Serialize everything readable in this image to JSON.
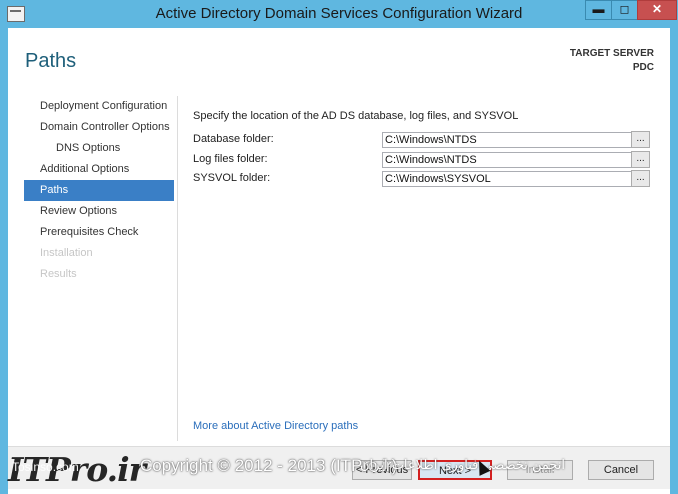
{
  "window": {
    "title": "Active Directory Domain Services Configuration Wizard",
    "controls": {
      "minimize": "▬",
      "maximize": "◻",
      "close": "✕"
    }
  },
  "header": {
    "page_title": "Paths",
    "target_label": "TARGET SERVER",
    "target_server": "PDC"
  },
  "sidebar": {
    "items": [
      {
        "label": "Deployment Configuration",
        "state": "normal"
      },
      {
        "label": "Domain Controller Options",
        "state": "normal"
      },
      {
        "label": "DNS Options",
        "state": "sub"
      },
      {
        "label": "Additional Options",
        "state": "normal"
      },
      {
        "label": "Paths",
        "state": "active"
      },
      {
        "label": "Review Options",
        "state": "normal"
      },
      {
        "label": "Prerequisites Check",
        "state": "normal"
      },
      {
        "label": "Installation",
        "state": "disabled"
      },
      {
        "label": "Results",
        "state": "disabled"
      }
    ]
  },
  "main": {
    "instruction": "Specify the location of the AD DS database, log files, and SYSVOL",
    "fields": [
      {
        "label": "Database folder:",
        "value": "C:\\Windows\\NTDS",
        "browse": "..."
      },
      {
        "label": "Log files folder:",
        "value": "C:\\Windows\\NTDS",
        "browse": "..."
      },
      {
        "label": "SYSVOL folder:",
        "value": "C:\\Windows\\SYSVOL",
        "browse": "..."
      }
    ],
    "more_link": "More about Active Directory paths"
  },
  "footer": {
    "previous": "< Previous",
    "next": "Next >",
    "install": "Install",
    "cancel": "Cancel"
  },
  "overlay": {
    "brand": "ITPro.ir",
    "brand_small": "Tosinso.com",
    "copyright": "Copyright © 2012 - 2013 (ITPro.ir)",
    "persian_text": "انجمن تخصصی فناوری اطلاعات ایران"
  },
  "colors": {
    "title_bar": "#5fb7e0",
    "active_nav": "#3a7fc6",
    "link": "#2a6ebb",
    "highlight_border": "#d42020"
  }
}
